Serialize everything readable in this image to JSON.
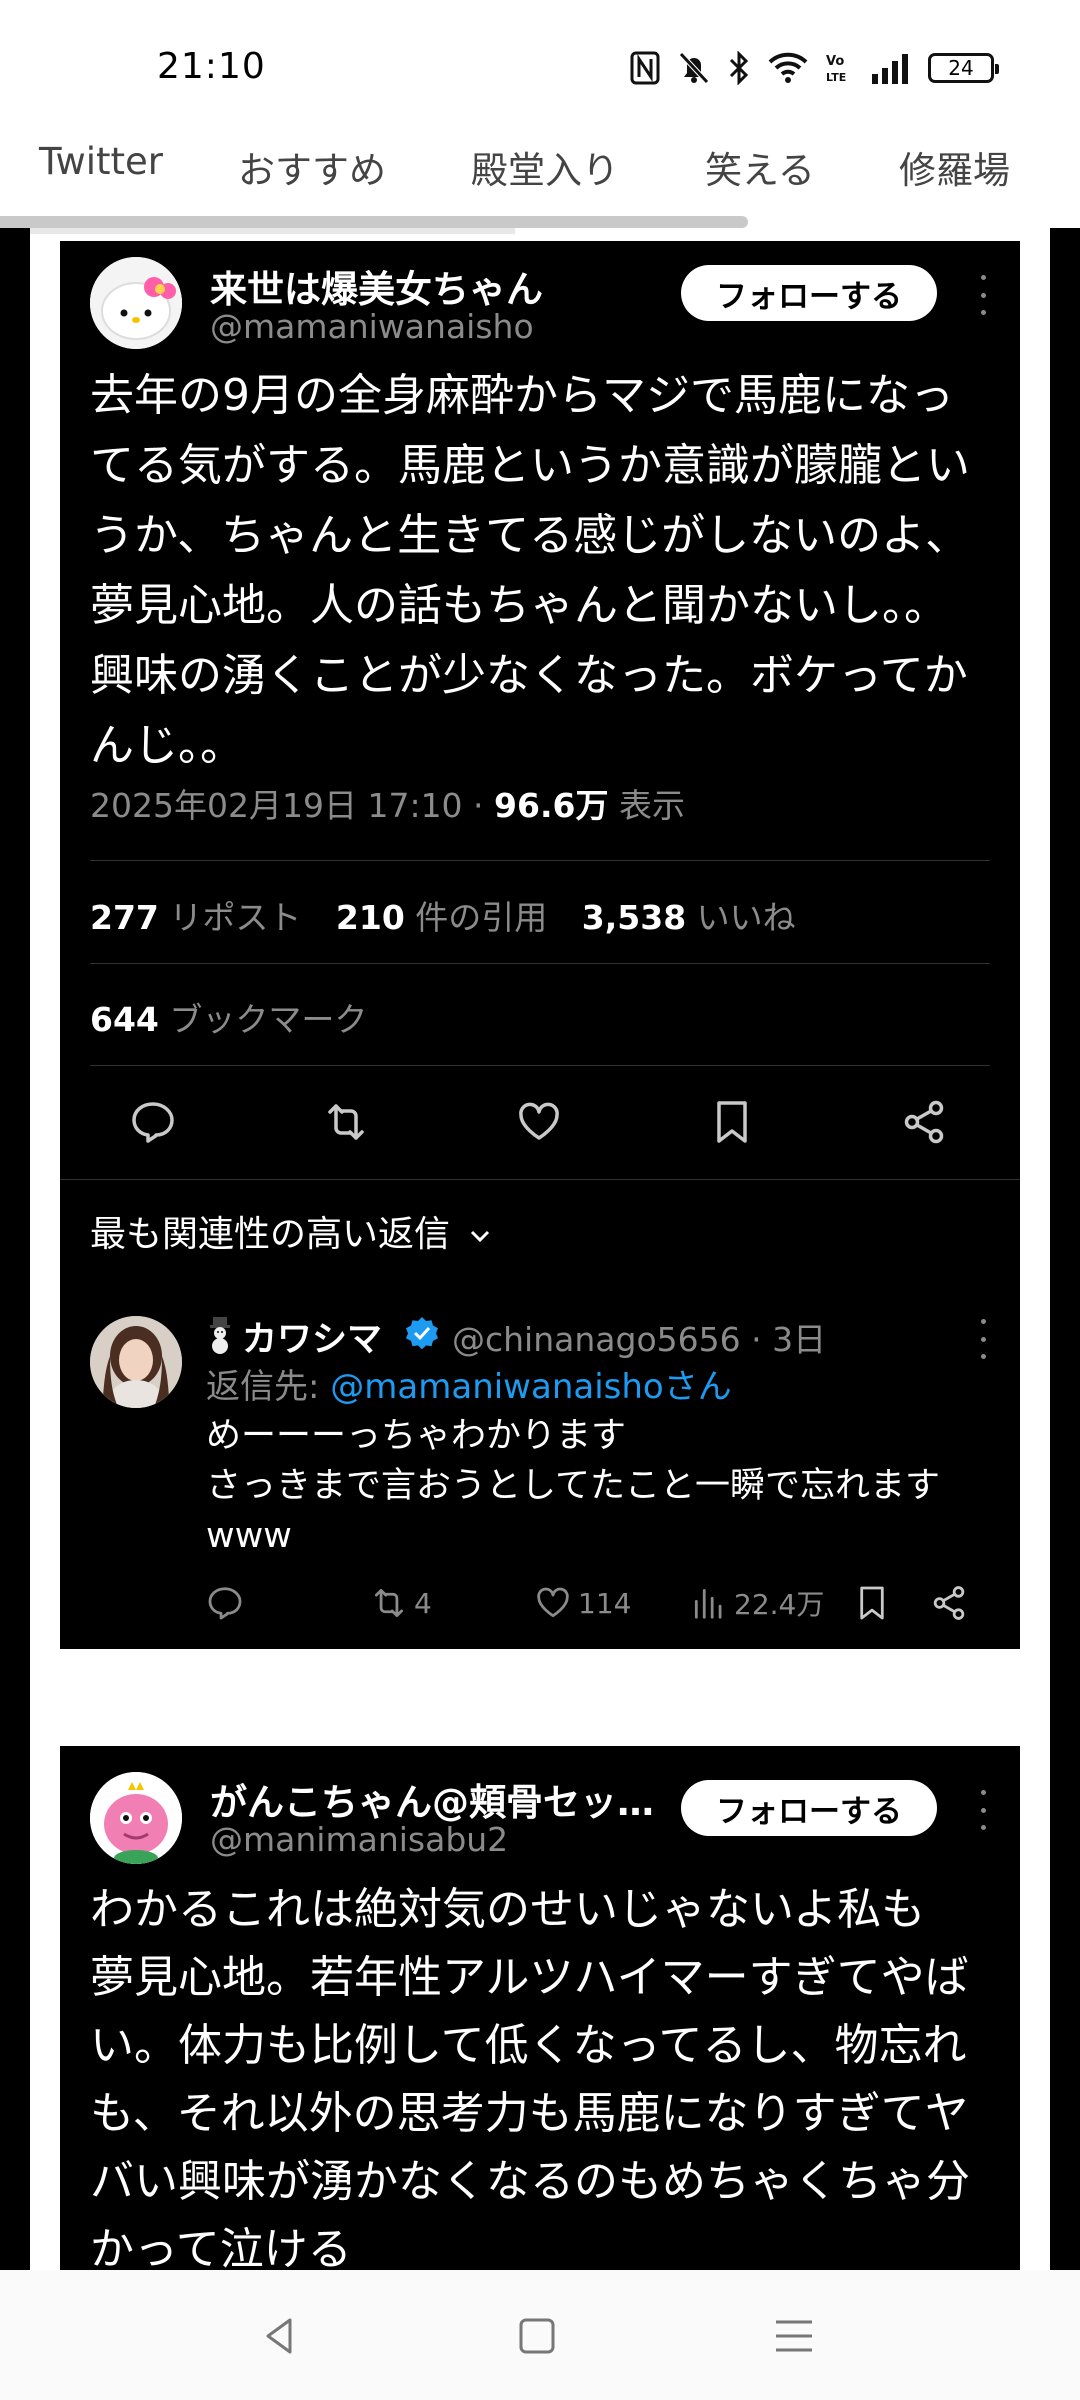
{
  "status_bar": {
    "time": "21:10",
    "battery": "24"
  },
  "tabs": [
    {
      "label": "Twitter"
    },
    {
      "label": "おすすめ"
    },
    {
      "label": "殿堂入り"
    },
    {
      "label": "笑える"
    },
    {
      "label": "修羅場"
    }
  ],
  "tweet1": {
    "display_name": "来世は爆美女ちゃん",
    "handle": "@mamaniwanaisho",
    "follow_label": "フォローする",
    "body": "去年の9月の全身麻酔からマジで馬鹿になっ\nてる気がする。馬鹿というか意識が朦朧とい\nうか、ちゃんと生きてる感じがしないのよ、\n夢見心地。人の話もちゃんと聞かないし。。\n興味の湧くことが少なくなった。ボケってか\nんじ。。",
    "timestamp": "2025年02月19日 17:10",
    "views": "96.6万",
    "views_label": "表示",
    "reposts": "277",
    "reposts_label": "リポスト",
    "quotes": "210",
    "quotes_label": "件の引用",
    "likes": "3,538",
    "likes_label": "いいね",
    "bookmarks": "644",
    "bookmarks_label": "ブックマーク",
    "relevance_label": "最も関連性の高い返信"
  },
  "reply": {
    "display_name": "カワシマ",
    "handle": "@chinanago5656",
    "time": "3日",
    "reply_to_prefix": "返信先:",
    "reply_to_user": "@mamaniwanaishoさん",
    "body": "めーーーっちゃわかります\nさっきまで言おうとしてたこと一瞬で忘れます\nwww",
    "retweets": "4",
    "likes": "114",
    "views": "22.4万"
  },
  "tweet2": {
    "display_name": "がんこちゃん@頬骨セッ…",
    "handle": "@manimanisabu2",
    "follow_label": "フォローする",
    "body": "わかるこれは絶対気のせいじゃないよ私も\n夢見心地。若年性アルツハイマーすぎてやば\nい。体力も比例して低くなってるし、物忘れ\nも、それ以外の思考力も馬鹿になりすぎてヤ\nバい興味が湧かなくなるのもめちゃくちゃ分\nかって泣ける"
  },
  "colors": {
    "accent": "#1d9bf0",
    "card_bg": "#000000",
    "muted": "#8b8b8b"
  },
  "icons": [
    "nfc-icon",
    "bell-off-icon",
    "bluetooth-icon",
    "wifi-icon",
    "volte-icon",
    "signal-icon",
    "battery-icon",
    "reply-icon",
    "retweet-icon",
    "like-icon",
    "bookmark-icon",
    "share-icon",
    "views-icon",
    "verified-icon",
    "chevron-down-icon",
    "back-icon",
    "home-icon",
    "menu-icon"
  ]
}
